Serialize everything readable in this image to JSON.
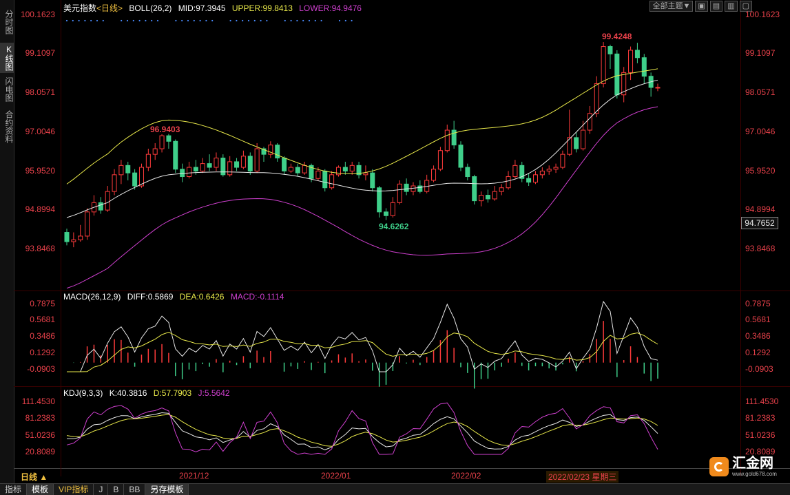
{
  "side_tabs": [
    {
      "label": "分时图",
      "active": false
    },
    {
      "label": "K线图",
      "active": true
    },
    {
      "label": "闪电图",
      "active": false
    },
    {
      "label": "合约资料",
      "active": false
    }
  ],
  "top_buttons": {
    "theme": "全部主题▼",
    "btn1": "▣",
    "btn2": "▤",
    "btn3": "▥",
    "btn4": "▢"
  },
  "main": {
    "name": "美元指数",
    "period": "<日线>",
    "indicator": "BOLL(26,2)",
    "mid": "MID:97.3945",
    "upper": "UPPER:99.8413",
    "lower": "LOWER:94.9476",
    "ticks": [
      "100.1623",
      "99.1097",
      "98.0571",
      "97.0046",
      "95.9520",
      "94.8994",
      "93.8468"
    ],
    "current_price": "94.7652",
    "hi_label": "99.4248",
    "mid_hi_label": "96.9403",
    "lo_label": "94.6262"
  },
  "macd": {
    "title": "MACD(26,12,9)",
    "diff": "DIFF:0.5869",
    "dea": "DEA:0.6426",
    "macd": "MACD:-0.1114",
    "ticks": [
      "0.7875",
      "0.5681",
      "0.3486",
      "0.1292",
      "-0.0903"
    ]
  },
  "kdj": {
    "title": "KDJ(9,3,3)",
    "k": "K:40.3816",
    "d": "D:57.7903",
    "j": "J:5.5642",
    "ticks": [
      "111.4530",
      "81.2383",
      "51.0236",
      "20.8089"
    ]
  },
  "x_labels": [
    "2021/12",
    "2022/01",
    "2022/02"
  ],
  "period_button": "日线 ▲",
  "date_box": "2022/02/23 星期三",
  "bottom_tabs": [
    {
      "label": "指标",
      "sel": false,
      "vip": false
    },
    {
      "label": "模板",
      "sel": true,
      "vip": false
    },
    {
      "label": "VIP指标",
      "sel": false,
      "vip": true
    },
    {
      "label": "J",
      "sel": false,
      "vip": false
    },
    {
      "label": "B",
      "sel": false,
      "vip": false
    },
    {
      "label": "BB",
      "sel": false,
      "vip": false
    },
    {
      "label": "另存模板",
      "sel": true,
      "vip": false
    }
  ],
  "brand": {
    "name": "汇金网",
    "url": "www.gold678.com"
  },
  "chart_data": {
    "type": "candlestick",
    "title": "美元指数",
    "ylim": [
      93.8468,
      100.1623
    ],
    "candles": [
      [
        94.3,
        94.05,
        94.4,
        93.95
      ],
      [
        94.05,
        94.1,
        94.3,
        93.9
      ],
      [
        94.1,
        94.2,
        94.5,
        94.05
      ],
      [
        94.2,
        94.85,
        94.95,
        94.1
      ],
      [
        94.85,
        95.1,
        95.3,
        94.75
      ],
      [
        95.1,
        94.9,
        95.25,
        94.8
      ],
      [
        94.9,
        95.4,
        95.55,
        94.85
      ],
      [
        95.4,
        95.85,
        96.0,
        95.3
      ],
      [
        95.85,
        96.1,
        96.25,
        95.6
      ],
      [
        96.1,
        95.9,
        96.2,
        95.7
      ],
      [
        95.9,
        95.55,
        96.0,
        95.45
      ],
      [
        95.55,
        96.05,
        96.15,
        95.5
      ],
      [
        96.05,
        96.4,
        96.55,
        95.95
      ],
      [
        96.4,
        96.55,
        96.7,
        96.25
      ],
      [
        96.55,
        96.9,
        96.94,
        96.45
      ],
      [
        96.9,
        96.75,
        96.95,
        96.55
      ],
      [
        96.75,
        96.0,
        96.8,
        95.9
      ],
      [
        96.0,
        95.8,
        96.15,
        95.65
      ],
      [
        95.8,
        96.05,
        96.2,
        95.75
      ],
      [
        96.05,
        95.95,
        96.25,
        95.85
      ],
      [
        95.95,
        96.15,
        96.3,
        95.9
      ],
      [
        96.15,
        96.05,
        96.4,
        95.95
      ],
      [
        96.05,
        96.3,
        96.45,
        95.95
      ],
      [
        96.3,
        95.85,
        96.4,
        95.8
      ],
      [
        95.85,
        96.2,
        96.35,
        95.8
      ],
      [
        96.2,
        96.05,
        96.3,
        95.95
      ],
      [
        96.05,
        96.35,
        96.5,
        96.0
      ],
      [
        96.35,
        95.95,
        96.45,
        95.85
      ],
      [
        95.95,
        96.55,
        96.7,
        95.9
      ],
      [
        96.55,
        96.4,
        96.6,
        96.2
      ],
      [
        96.4,
        96.65,
        96.75,
        96.3
      ],
      [
        96.65,
        96.3,
        96.7,
        96.2
      ],
      [
        96.3,
        95.95,
        96.35,
        95.85
      ],
      [
        95.95,
        96.05,
        96.15,
        95.9
      ],
      [
        96.05,
        95.9,
        96.15,
        95.8
      ],
      [
        95.9,
        96.1,
        96.2,
        95.85
      ],
      [
        96.1,
        95.75,
        96.15,
        95.65
      ],
      [
        95.75,
        95.95,
        96.05,
        95.7
      ],
      [
        95.95,
        95.5,
        96.0,
        95.4
      ],
      [
        95.5,
        95.85,
        95.95,
        95.45
      ],
      [
        95.85,
        96.05,
        96.1,
        95.8
      ],
      [
        96.05,
        95.95,
        96.2,
        95.85
      ],
      [
        95.95,
        96.1,
        96.2,
        95.85
      ],
      [
        96.1,
        95.85,
        96.2,
        95.75
      ],
      [
        95.85,
        95.9,
        96.1,
        95.7
      ],
      [
        95.9,
        95.5,
        96.0,
        95.4
      ],
      [
        95.5,
        94.85,
        95.55,
        94.7
      ],
      [
        94.85,
        94.75,
        94.95,
        94.63
      ],
      [
        94.75,
        95.1,
        95.25,
        94.7
      ],
      [
        95.1,
        95.6,
        95.7,
        95.05
      ],
      [
        95.6,
        95.4,
        95.75,
        95.3
      ],
      [
        95.4,
        95.55,
        95.65,
        95.3
      ],
      [
        95.55,
        95.4,
        95.7,
        95.35
      ],
      [
        95.4,
        95.7,
        95.85,
        95.35
      ],
      [
        95.7,
        96.0,
        96.1,
        95.65
      ],
      [
        96.0,
        96.5,
        96.6,
        95.95
      ],
      [
        96.5,
        97.05,
        97.2,
        96.45
      ],
      [
        97.05,
        96.65,
        97.3,
        96.55
      ],
      [
        96.65,
        96.05,
        96.75,
        95.95
      ],
      [
        96.05,
        95.8,
        96.15,
        95.7
      ],
      [
        95.8,
        95.15,
        95.85,
        95.05
      ],
      [
        95.15,
        95.3,
        95.4,
        95.0
      ],
      [
        95.3,
        95.2,
        95.45,
        95.1
      ],
      [
        95.2,
        95.4,
        95.55,
        95.15
      ],
      [
        95.4,
        95.5,
        95.6,
        95.3
      ],
      [
        95.5,
        95.8,
        95.95,
        95.45
      ],
      [
        95.8,
        96.1,
        96.25,
        95.75
      ],
      [
        96.1,
        95.75,
        96.2,
        95.65
      ],
      [
        95.75,
        95.65,
        95.9,
        95.55
      ],
      [
        95.65,
        95.85,
        95.95,
        95.6
      ],
      [
        95.85,
        95.95,
        96.05,
        95.75
      ],
      [
        95.95,
        96.0,
        96.1,
        95.85
      ],
      [
        96.0,
        96.05,
        96.15,
        95.9
      ],
      [
        96.05,
        96.4,
        96.5,
        96.0
      ],
      [
        96.4,
        96.85,
        97.6,
        96.35
      ],
      [
        96.85,
        96.55,
        97.0,
        96.45
      ],
      [
        96.55,
        97.05,
        97.3,
        96.5
      ],
      [
        97.05,
        97.5,
        97.7,
        96.95
      ],
      [
        97.5,
        98.3,
        98.5,
        97.4
      ],
      [
        98.3,
        99.3,
        99.42,
        98.2
      ],
      [
        99.3,
        99.1,
        99.35,
        98.7
      ],
      [
        99.1,
        98.0,
        99.2,
        97.9
      ],
      [
        98.0,
        98.6,
        98.75,
        97.8
      ],
      [
        98.6,
        99.2,
        99.3,
        98.4
      ],
      [
        99.2,
        99.0,
        99.4,
        98.85
      ],
      [
        99.0,
        98.5,
        99.1,
        98.3
      ],
      [
        98.5,
        98.2,
        98.6,
        97.95
      ],
      [
        98.2,
        98.2,
        98.3,
        98.1
      ]
    ],
    "boll_mid_range": [
      93.9,
      97.4
    ],
    "boll_upper_range": [
      94.5,
      99.84
    ],
    "boll_lower_range": [
      92.5,
      94.95
    ]
  }
}
